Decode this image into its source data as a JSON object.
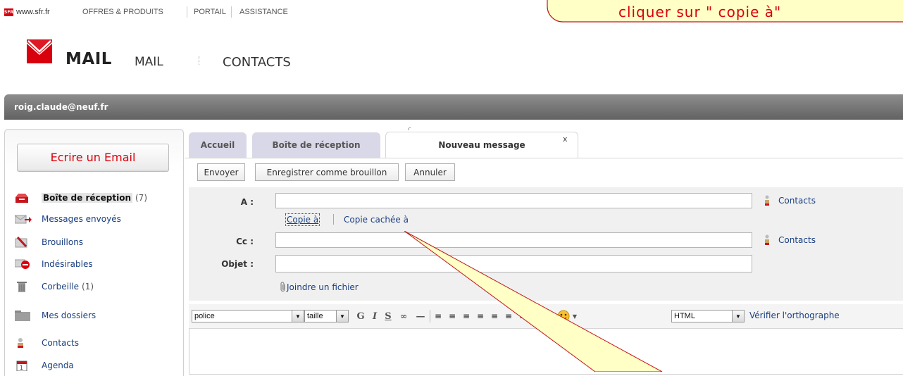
{
  "topnav": {
    "logo_text": "SFR",
    "site": "www.sfr.fr",
    "items": [
      "OFFRES & PRODUITS",
      "PORTAIL",
      "ASSISTANCE"
    ]
  },
  "brand": {
    "title": "MAIL",
    "nav": [
      "MAIL",
      "CONTACTS"
    ]
  },
  "user": {
    "email": "roig.claude@neuf.fr"
  },
  "sidebar": {
    "compose_label": "Ecrire un Email",
    "items": [
      {
        "label": "Boîte de réception",
        "count": "(7)",
        "icon": "inbox-icon"
      },
      {
        "label": "Messages envoyés",
        "count": "",
        "icon": "sent-icon"
      },
      {
        "label": "Brouillons",
        "count": "",
        "icon": "drafts-icon"
      },
      {
        "label": "Indésirables",
        "count": "",
        "icon": "spam-icon"
      },
      {
        "label": "Corbeille",
        "count": "(1)",
        "icon": "trash-icon"
      },
      {
        "label": "Mes dossiers",
        "count": "",
        "icon": "folder-icon"
      },
      {
        "label": "Contacts",
        "count": "",
        "icon": "contacts-icon"
      },
      {
        "label": "Agenda",
        "count": "",
        "icon": "calendar-icon"
      }
    ]
  },
  "tabs": [
    {
      "label": "Accueil"
    },
    {
      "label": "Boîte de réception"
    },
    {
      "label": "Nouveau message"
    }
  ],
  "tab_close": "x",
  "toolbar": {
    "send": "Envoyer",
    "save_draft": "Enregistrer comme brouillon",
    "cancel": "Annuler"
  },
  "compose": {
    "to_label": "A :",
    "cc_label": "Cc :",
    "subject_label": "Objet :",
    "contacts_label": "Contacts",
    "copy_to": "Copie à",
    "bcc": "Copie cachée à",
    "attach": "Joindre un fichier"
  },
  "editor": {
    "font_select": "police",
    "size_select": "taille",
    "format_select": "HTML",
    "spellcheck": "Vérifier l'orthographe"
  },
  "callout": {
    "text": "cliquer sur \" copie à\"",
    "fill": "#ffffc6",
    "border": "#c21717",
    "text_color": "#d8000c"
  }
}
